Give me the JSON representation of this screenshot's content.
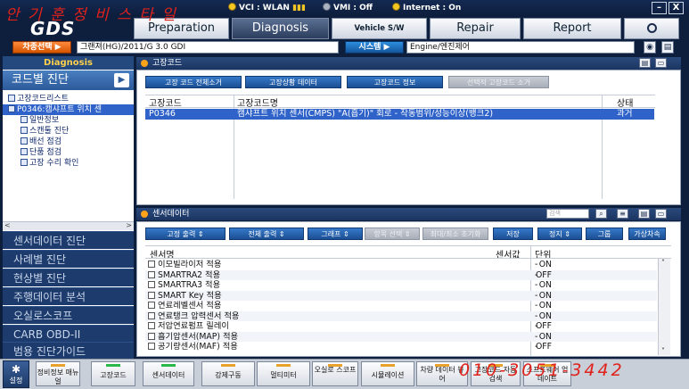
{
  "status": {
    "vci": "VCI : WLAN",
    "vmi": "VMI : Off",
    "internet": "Internet : On",
    "minimize": "–",
    "close": "X"
  },
  "logo": "GDS",
  "tabs": [
    "Preparation",
    "Diagnosis",
    "Vehicle S/W Management",
    "Repair",
    "Report"
  ],
  "vehicle": {
    "select_btn": "차종선택 ▶",
    "vehicle_value": "그랜져(HG)/2011/G 3.0 GDI",
    "system_btn": "시스템 ▶",
    "system_value": "Engine/엔진제어"
  },
  "sidebar": {
    "header": "Diagnosis",
    "code_diag": "코드별 진단",
    "tree": [
      "고장코드리스트",
      "P0346:캠샤프트 위치 센",
      "일반정보",
      "스캔툴 진단",
      "배선 점검",
      "단품 점검",
      "고장 수리 확인"
    ],
    "menu": [
      "센서데이터 진단",
      "사례별 진단",
      "현상별 진단",
      "주행데이터 분석",
      "오실로스코프",
      "CARB OBD-II",
      "범용 진단가이드"
    ]
  },
  "dtc_panel": {
    "title": "고장코드",
    "buttons": [
      "고장 코드 전체소거",
      "고장상황 데이터",
      "고장코드 정보",
      "선택적 고장코드 소거"
    ],
    "columns": [
      "고장코드",
      "고장코드명",
      "상태"
    ],
    "rows": [
      {
        "code": "P0346",
        "name": "캠샤프트 위치 센서(CMPS) \"A(흡기)\" 회로 - 작동범위/성능이상(뱅크2)",
        "status": "과거"
      }
    ]
  },
  "sensor_panel": {
    "title": "센서데이터",
    "filter_placeholder": "검색",
    "buttons": [
      "고정 출력",
      "전체 출력",
      "그래프",
      "항목 선택",
      "최대/최소 초기화",
      "저장",
      "정지",
      "그룹",
      "가상차속"
    ],
    "columns": [
      "센서명",
      "센서값",
      "단위"
    ],
    "rows": [
      {
        "name": "이모빌라이저 적용",
        "value": "ON",
        "unit": "-"
      },
      {
        "name": "SMARTRA2 적용",
        "value": "OFF",
        "unit": "-"
      },
      {
        "name": "SMARTRA3 적용",
        "value": "ON",
        "unit": "-"
      },
      {
        "name": "SMART Key 적용",
        "value": "ON",
        "unit": "-"
      },
      {
        "name": "연료레벨센서 적용",
        "value": "ON",
        "unit": "-"
      },
      {
        "name": "연료탱크 압력센서 적용",
        "value": "ON",
        "unit": "-"
      },
      {
        "name": "저압연료펌프 릴레이",
        "value": "OFF",
        "unit": "-"
      },
      {
        "name": "흡기압센서(MAP) 적용",
        "value": "ON",
        "unit": "-"
      },
      {
        "name": "공기량센서(MAF) 적용",
        "value": "OFF",
        "unit": "-"
      }
    ]
  },
  "bottom": {
    "settings": "설정",
    "buttons": [
      "정비정보 매뉴얼",
      "고장코드",
      "센서데이터",
      "강제구동",
      "멀티미터",
      "오실로 스코프",
      "시뮬레이션",
      "차량 데이터 뷰어",
      "고장코드 자동검색",
      "소프트웨어 업데이트"
    ]
  },
  "handwriting": {
    "top": "안 기 훈   정 비 스 타 일",
    "phone": "010-3051-3442"
  }
}
